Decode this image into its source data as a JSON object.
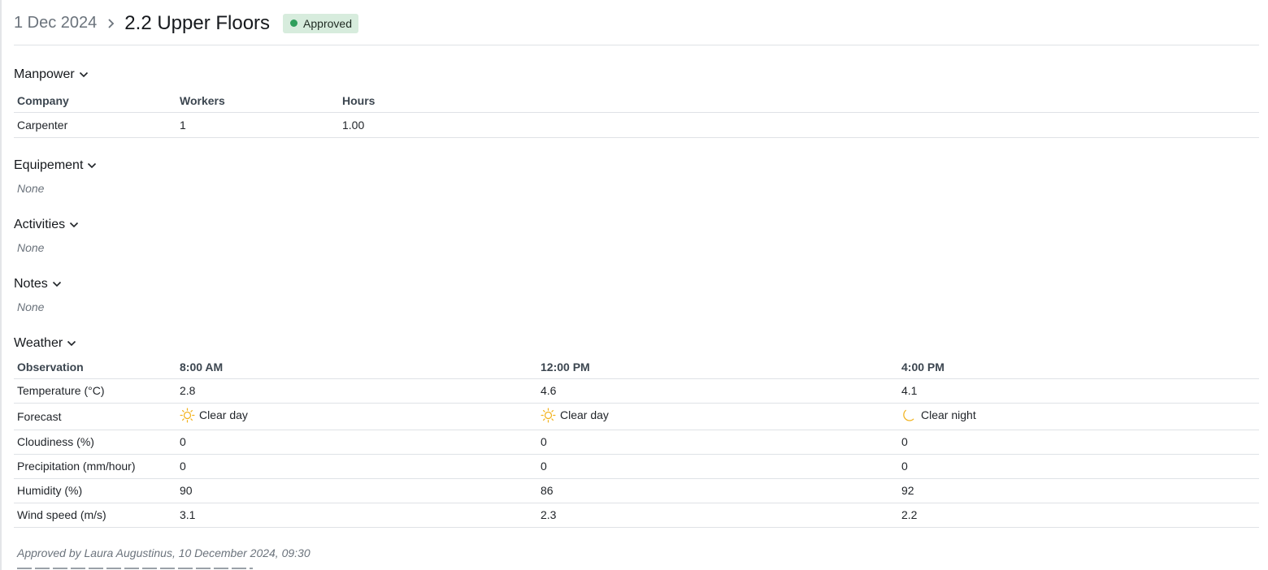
{
  "header": {
    "breadcrumb_date": "1 Dec 2024",
    "title": "2.2 Upper Floors",
    "status": "Approved"
  },
  "manpower": {
    "title": "Manpower",
    "columns": [
      "Company",
      "Workers",
      "Hours"
    ],
    "rows": [
      [
        "Carpenter",
        "1",
        "1.00"
      ]
    ]
  },
  "equipement": {
    "title": "Equipement",
    "empty": "None"
  },
  "activities": {
    "title": "Activities",
    "empty": "None"
  },
  "notes": {
    "title": "Notes",
    "empty": "None"
  },
  "weather": {
    "title": "Weather",
    "columns": [
      "Observation",
      "8:00 AM",
      "12:00 PM",
      "4:00 PM"
    ],
    "rows": [
      [
        "Temperature (°C)",
        "2.8",
        "4.6",
        "4.1"
      ],
      [
        "Forecast",
        "Clear day",
        "Clear day",
        "Clear night"
      ],
      [
        "Cloudiness (%)",
        "0",
        "0",
        "0"
      ],
      [
        "Precipitation (mm/hour)",
        "0",
        "0",
        "0"
      ],
      [
        "Humidity (%)",
        "90",
        "86",
        "92"
      ],
      [
        "Wind speed (m/s)",
        "3.1",
        "2.3",
        "2.2"
      ]
    ],
    "forecast_icons": [
      "sun-icon",
      "sun-icon",
      "moon-icon"
    ]
  },
  "footer": {
    "approved_by": "Approved by Laura Augustinus, 10 December 2024, 09:30"
  },
  "colors": {
    "badge_bg": "#d7ecdd",
    "badge_dot": "#2e9e5b",
    "weather_icon": "#f2b21c"
  }
}
